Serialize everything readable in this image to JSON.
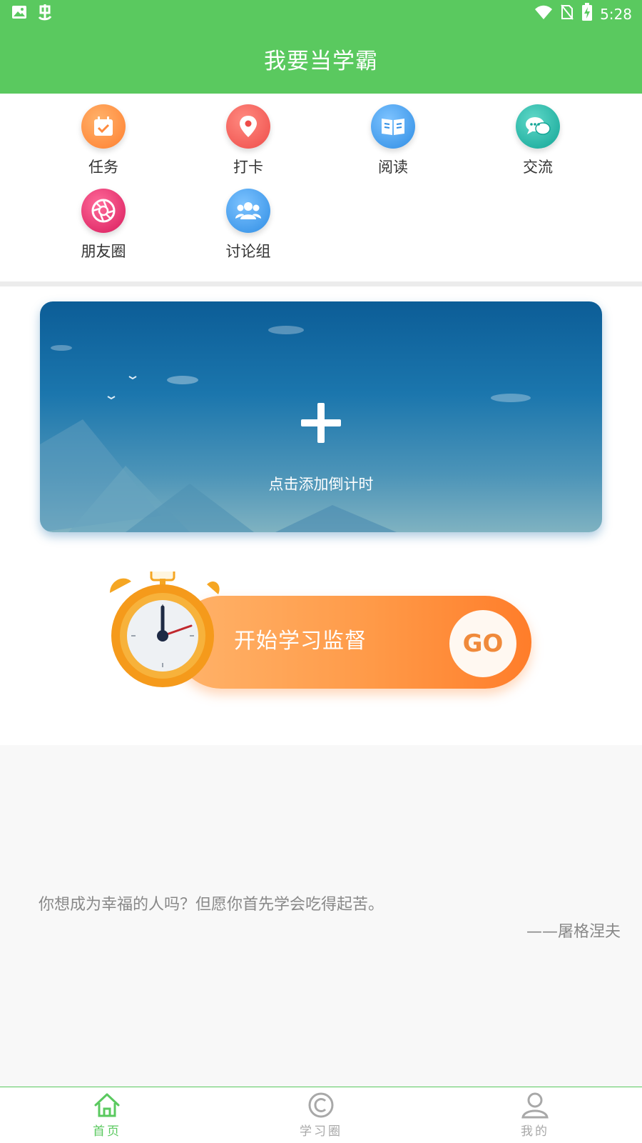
{
  "status_bar": {
    "time": "5:28",
    "left_icons": [
      "image-icon",
      "bug-icon"
    ],
    "right_icons": [
      "wifi-icon",
      "no-sim-icon",
      "battery-charging-icon"
    ]
  },
  "header": {
    "title": "我要当学霸"
  },
  "features": [
    {
      "label": "任务",
      "icon": "calendar-check-icon",
      "color": "#ff8a3d"
    },
    {
      "label": "打卡",
      "icon": "location-pin-icon",
      "color": "#f25a55"
    },
    {
      "label": "阅读",
      "icon": "book-icon",
      "color": "#3d9ae8"
    },
    {
      "label": "交流",
      "icon": "chat-bubbles-icon",
      "color": "#22b5a6"
    },
    {
      "label": "朋友圈",
      "icon": "aperture-icon",
      "color": "#e8356e"
    },
    {
      "label": "讨论组",
      "icon": "group-icon",
      "color": "#3d9ae8"
    }
  ],
  "countdown": {
    "label": "点击添加倒计时"
  },
  "study": {
    "label": "开始学习监督",
    "go_label": "GO"
  },
  "quote": {
    "text": "你想成为幸福的人吗？但愿你首先学会吃得起苦。",
    "author": "——屠格涅夫"
  },
  "bottom_nav": {
    "active_color": "#5ac95f",
    "inactive_color": "#a8a8a8",
    "tabs": [
      {
        "label": "首页",
        "icon": "home-icon",
        "active": true
      },
      {
        "label": "学习圈",
        "icon": "copyright-circle-icon",
        "active": false
      },
      {
        "label": "我的",
        "icon": "user-icon",
        "active": false
      }
    ]
  }
}
